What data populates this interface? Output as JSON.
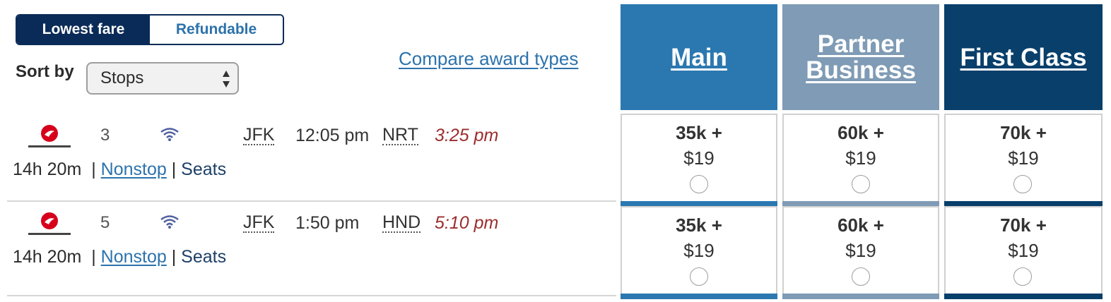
{
  "fare_toggle": {
    "lowest_fare": "Lowest fare",
    "refundable": "Refundable"
  },
  "sort": {
    "label": "Sort by",
    "selected": "Stops"
  },
  "compare_link": "Compare award types",
  "fare_classes": [
    {
      "name": "Main",
      "color": "#2b78b0"
    },
    {
      "name": "Partner Business",
      "color": "#7f9bb5"
    },
    {
      "name": "First Class",
      "color": "#083f6b"
    }
  ],
  "flights": [
    {
      "airline_icon": "japan-airlines-logo-icon",
      "stops": "3",
      "wifi_icon": "wifi-icon",
      "depart_airport": "JFK",
      "depart_time": "12:05 pm",
      "arrive_airport": "NRT",
      "arrive_time": "3:25 pm",
      "duration": "14h 20m",
      "nonstop": "Nonstop",
      "seats": "Seats",
      "fares": [
        {
          "miles": "35k +",
          "tax": "$19"
        },
        {
          "miles": "60k +",
          "tax": "$19"
        },
        {
          "miles": "70k +",
          "tax": "$19"
        }
      ]
    },
    {
      "airline_icon": "japan-airlines-logo-icon",
      "stops": "5",
      "wifi_icon": "wifi-icon",
      "depart_airport": "JFK",
      "depart_time": "1:50 pm",
      "arrive_airport": "HND",
      "arrive_time": "5:10 pm",
      "duration": "14h 20m",
      "nonstop": "Nonstop",
      "seats": "Seats",
      "fares": [
        {
          "miles": "35k +",
          "tax": "$19"
        },
        {
          "miles": "60k +",
          "tax": "$19"
        },
        {
          "miles": "70k +",
          "tax": "$19"
        }
      ]
    }
  ]
}
